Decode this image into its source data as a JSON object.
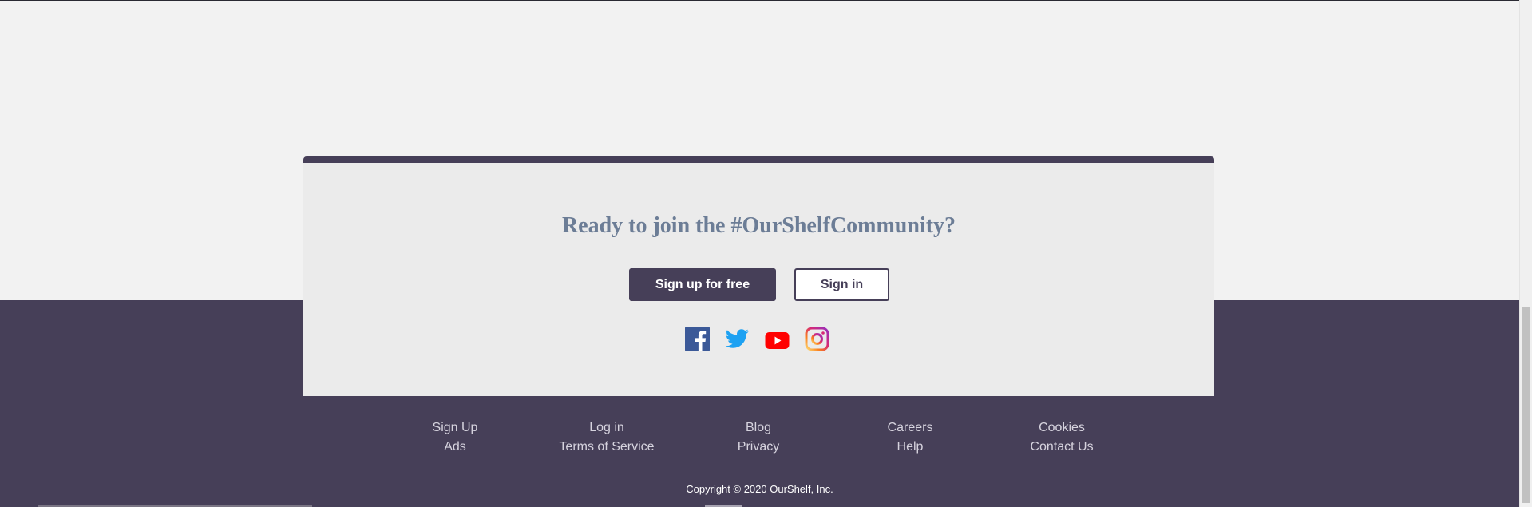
{
  "cta": {
    "heading": "Ready to join the #OurShelfCommunity?",
    "signup_label": "Sign up for free",
    "signin_label": "Sign in"
  },
  "social": {
    "items": [
      {
        "name": "facebook-icon",
        "color": "#3b5998"
      },
      {
        "name": "twitter-icon",
        "color": "#1da1f2"
      },
      {
        "name": "youtube-icon",
        "color": "#ff0000"
      },
      {
        "name": "instagram-icon",
        "color": "#e1306c"
      }
    ]
  },
  "footer": {
    "links": [
      "Sign Up",
      "Log in",
      "Blog",
      "Careers",
      "Cookies",
      "Ads",
      "Terms of Service",
      "Privacy",
      "Help",
      "Contact Us"
    ],
    "copyright": "Copyright © 2020 OurShelf, Inc."
  },
  "colors": {
    "brand": "#463f58",
    "heading": "#6c7d96",
    "page_background": "#f2f2f2",
    "card_background": "#ebebeb"
  }
}
